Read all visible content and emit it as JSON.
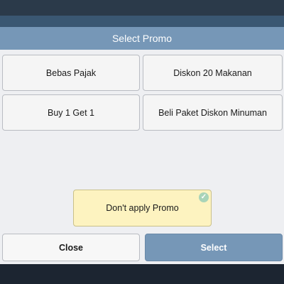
{
  "dialog": {
    "title": "Select Promo",
    "promos": [
      {
        "label": "Bebas Pajak"
      },
      {
        "label": "Diskon 20 Makanan"
      },
      {
        "label": "Buy 1 Get 1"
      },
      {
        "label": "Beli Paket Diskon Minuman"
      }
    ],
    "no_promo_label": "Don't apply Promo",
    "no_promo_selected_icon": "check-icon",
    "close_label": "Close",
    "select_label": "Select"
  },
  "colors": {
    "header": "#7697b7",
    "select_button": "#7697b7",
    "no_promo_bg": "#fdf3c0",
    "check": "#a9d4b8"
  }
}
